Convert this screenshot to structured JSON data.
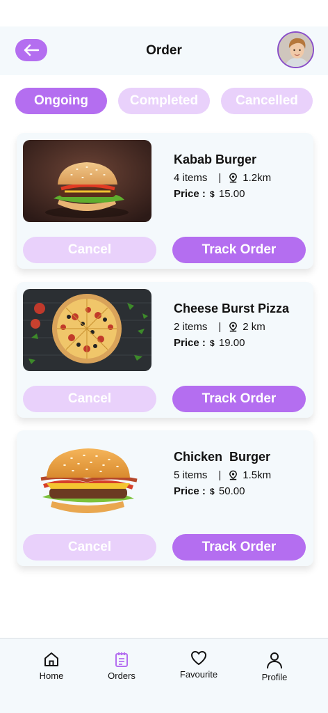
{
  "header": {
    "title": "Order"
  },
  "tabs": [
    {
      "label": "Ongoing",
      "active": true
    },
    {
      "label": "Completed",
      "active": false
    },
    {
      "label": "Cancelled",
      "active": false
    }
  ],
  "orders": [
    {
      "name": "Kabab Burger",
      "items": "4 items",
      "distance": "1.2km",
      "price_label": "Price :",
      "currency": "$",
      "price": "15.00",
      "cancel_label": "Cancel",
      "track_label": "Track Order",
      "image": "kabab-burger"
    },
    {
      "name": "Cheese Burst Pizza",
      "items": "2 items",
      "distance": "2 km",
      "price_label": "Price :",
      "currency": "$",
      "price": "19.00",
      "cancel_label": "Cancel",
      "track_label": "Track Order",
      "image": "cheese-burst-pizza"
    },
    {
      "name": "Chicken  Burger",
      "items": "5 items",
      "distance": "1.5km",
      "price_label": "Price :",
      "currency": "$",
      "price": "50.00",
      "cancel_label": "Cancel",
      "track_label": "Track Order",
      "image": "chicken-burger"
    }
  ],
  "nav": [
    {
      "label": "Home",
      "icon": "home-icon"
    },
    {
      "label": "Orders",
      "icon": "orders-icon",
      "active": true
    },
    {
      "label": "Favourite",
      "icon": "heart-icon"
    },
    {
      "label": "Profile",
      "icon": "profile-icon"
    }
  ],
  "colors": {
    "accent": "#b46ef0",
    "accent_light": "#e9d1fb",
    "surface": "#f4f9fc"
  }
}
